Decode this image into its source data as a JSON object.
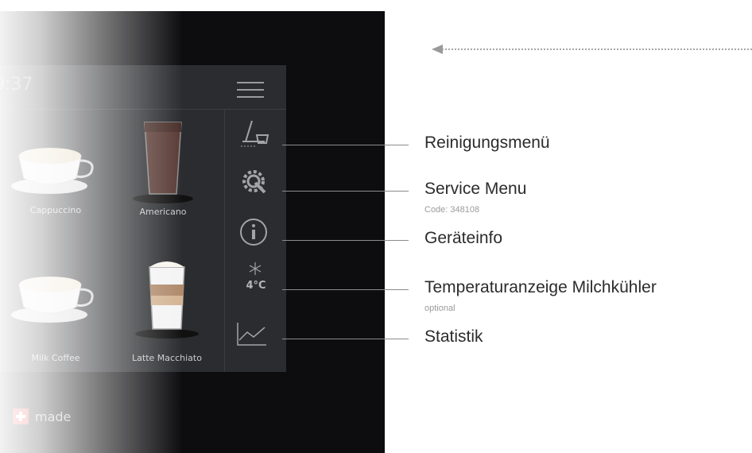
{
  "status": {
    "time": "9:37"
  },
  "products": [
    {
      "label": "Cappuccino"
    },
    {
      "label": "Americano"
    },
    {
      "label": "Milk Coffee"
    },
    {
      "label": "Latte Macchiato"
    }
  ],
  "sidebar": {
    "temperature": "4°C"
  },
  "branding": {
    "made_label": "made"
  },
  "callouts": {
    "cleaning": "Reinigungsmenü",
    "service": "Service Menu",
    "service_code": "Code: 348108",
    "device_info": "Geräteinfo",
    "temperature": "Temperaturanzeige Milchkühler",
    "temperature_note": "optional",
    "statistics": "Statistik"
  },
  "icons": [
    "menu-icon",
    "cleaning-icon",
    "service-gear-icon",
    "info-icon",
    "snowflake-icon",
    "statistics-chart-icon",
    "swiss-cross-icon",
    "arrow-left-icon"
  ]
}
